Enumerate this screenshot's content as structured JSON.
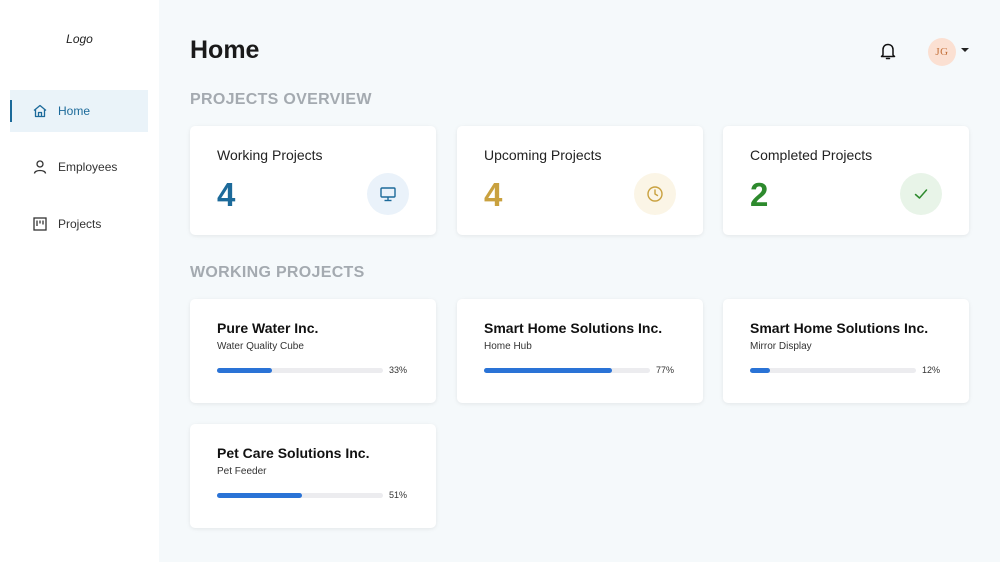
{
  "sidebar": {
    "logo": "Logo",
    "items": [
      {
        "label": "Home",
        "icon": "home-icon",
        "active": true
      },
      {
        "label": "Employees",
        "icon": "person-icon",
        "active": false
      },
      {
        "label": "Projects",
        "icon": "board-icon",
        "active": false
      }
    ]
  },
  "header": {
    "title": "Home",
    "avatar_initials": "JG"
  },
  "overview": {
    "heading": "PROJECTS OVERVIEW",
    "cards": [
      {
        "label": "Working Projects",
        "value": "4",
        "icon": "monitor-icon",
        "color": "#1c6a9a",
        "icon_bg": "#eaf2fa"
      },
      {
        "label": "Upcoming Projects",
        "value": "4",
        "icon": "clock-icon",
        "color": "#c9a13f",
        "icon_bg": "#fbf5e6"
      },
      {
        "label": "Completed Projects",
        "value": "2",
        "icon": "check-icon",
        "color": "#2d8a2d",
        "icon_bg": "#e8f4e8"
      }
    ]
  },
  "working": {
    "heading": "WORKING PROJECTS",
    "projects": [
      {
        "name": "Pure Water Inc.",
        "product": "Water Quality Cube",
        "progress": 33,
        "progress_label": "33%"
      },
      {
        "name": "Smart Home Solutions Inc.",
        "product": "Home Hub",
        "progress": 77,
        "progress_label": "77%"
      },
      {
        "name": "Smart Home Solutions Inc.",
        "product": "Mirror Display",
        "progress": 12,
        "progress_label": "12%"
      },
      {
        "name": "Pet Care Solutions Inc.",
        "product": "Pet Feeder",
        "progress": 51,
        "progress_label": "51%"
      }
    ]
  }
}
